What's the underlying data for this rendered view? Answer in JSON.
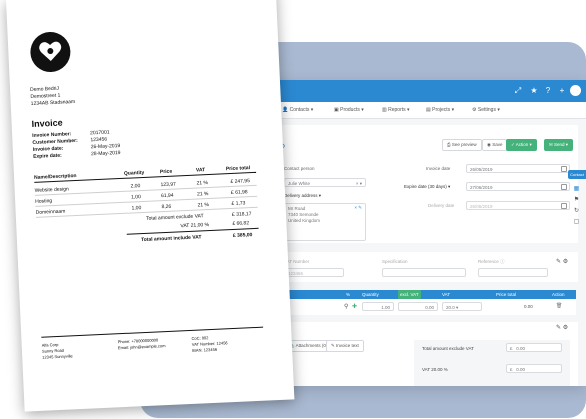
{
  "app": {
    "nav": [
      {
        "icon": "person-icon",
        "label": "Contacts"
      },
      {
        "icon": "box-icon",
        "label": "Products"
      },
      {
        "icon": "chart-icon",
        "label": "Reports"
      },
      {
        "icon": "folder-icon",
        "label": "Projects"
      },
      {
        "icon": "gear-icon",
        "label": "Settings"
      }
    ],
    "toolbar": {
      "preview": "See preview",
      "save": "Save",
      "action": "Action",
      "send": "Send"
    },
    "contact_person": {
      "label": "Contact person",
      "value": "Julie White"
    },
    "delivery_address": {
      "label": "Delivery address",
      "lines": [
        "Mr Road",
        "7340 Semonde",
        "United Kingdom"
      ]
    },
    "invoice_date": {
      "label": "Invoice date",
      "value": "26/05/2019"
    },
    "expire_date": {
      "label": "Expire date (30 days)",
      "value": "27/06/2019"
    },
    "delivery_date": {
      "label": "Delivery date",
      "value": "26/05/2019"
    },
    "vat_number": {
      "label": "VAT Number",
      "value": "123456"
    },
    "specification": {
      "label": "Specification"
    },
    "reference": {
      "label": "Reference"
    },
    "table_headers": [
      "%",
      "Quantity",
      "Price",
      "VAT",
      "Price total",
      "Action"
    ],
    "price_badge": "excl. VAT",
    "row": {
      "qty": "1.00",
      "price": "0.00",
      "vat": "20.0",
      "total": "0.00"
    },
    "attachments": "Attachments (0)",
    "invoice_text": "Invoice text",
    "totals": [
      {
        "label": "Total amount exclude VAT",
        "cur": "£",
        "value": "0.00"
      },
      {
        "label": "VAT 20.00 %",
        "cur": "£",
        "value": "0.00"
      }
    ],
    "rail_tab": "Contact"
  },
  "invoice": {
    "from": [
      "Demo BedriJ",
      "Demostreet 1",
      "1234AB Stadsnaam"
    ],
    "title": "Invoice",
    "meta": [
      {
        "label": "Invoice Number:",
        "value": "2017001"
      },
      {
        "label": "Customer Number:",
        "value": "123456"
      },
      {
        "label": "Invoice date:",
        "value": "26-May-2019"
      },
      {
        "label": "Expire date:",
        "value": "28-May-2019"
      }
    ],
    "headers": {
      "desc": "Name/Description",
      "qty": "Quantity",
      "price": "Price",
      "vat": "VAT",
      "total": "Price total"
    },
    "lines": [
      {
        "desc": "Website design",
        "qty": "2,00",
        "price": "123,97",
        "vat": "21 %",
        "total": "£ 247,95"
      },
      {
        "desc": "Hosting",
        "qty": "1,00",
        "price": "61,94",
        "vat": "21 %",
        "total": "£ 61,98"
      },
      {
        "desc": "Domeinnaam",
        "qty": "1,00",
        "price": "8,26",
        "vat": "21 %",
        "total": "£ 1,73"
      }
    ],
    "subtotals": [
      {
        "label": "Total amount exclude VAT",
        "value": "£ 318,17"
      },
      {
        "label": "VAT 21,00 %",
        "value": "£ 66,82"
      }
    ],
    "grand": {
      "label": "Total amount include VAT",
      "value": "£ 385,00"
    },
    "footer": {
      "col1": [
        "Alfa Corp",
        "Sunny Road",
        "12345 Sunnyville"
      ],
      "col2": [
        "Phone: +78000000000",
        "Email: john@example.com"
      ],
      "col3": [
        "CoC: 002",
        "VAT Number: 12456",
        "IBAN: 123456"
      ]
    }
  }
}
